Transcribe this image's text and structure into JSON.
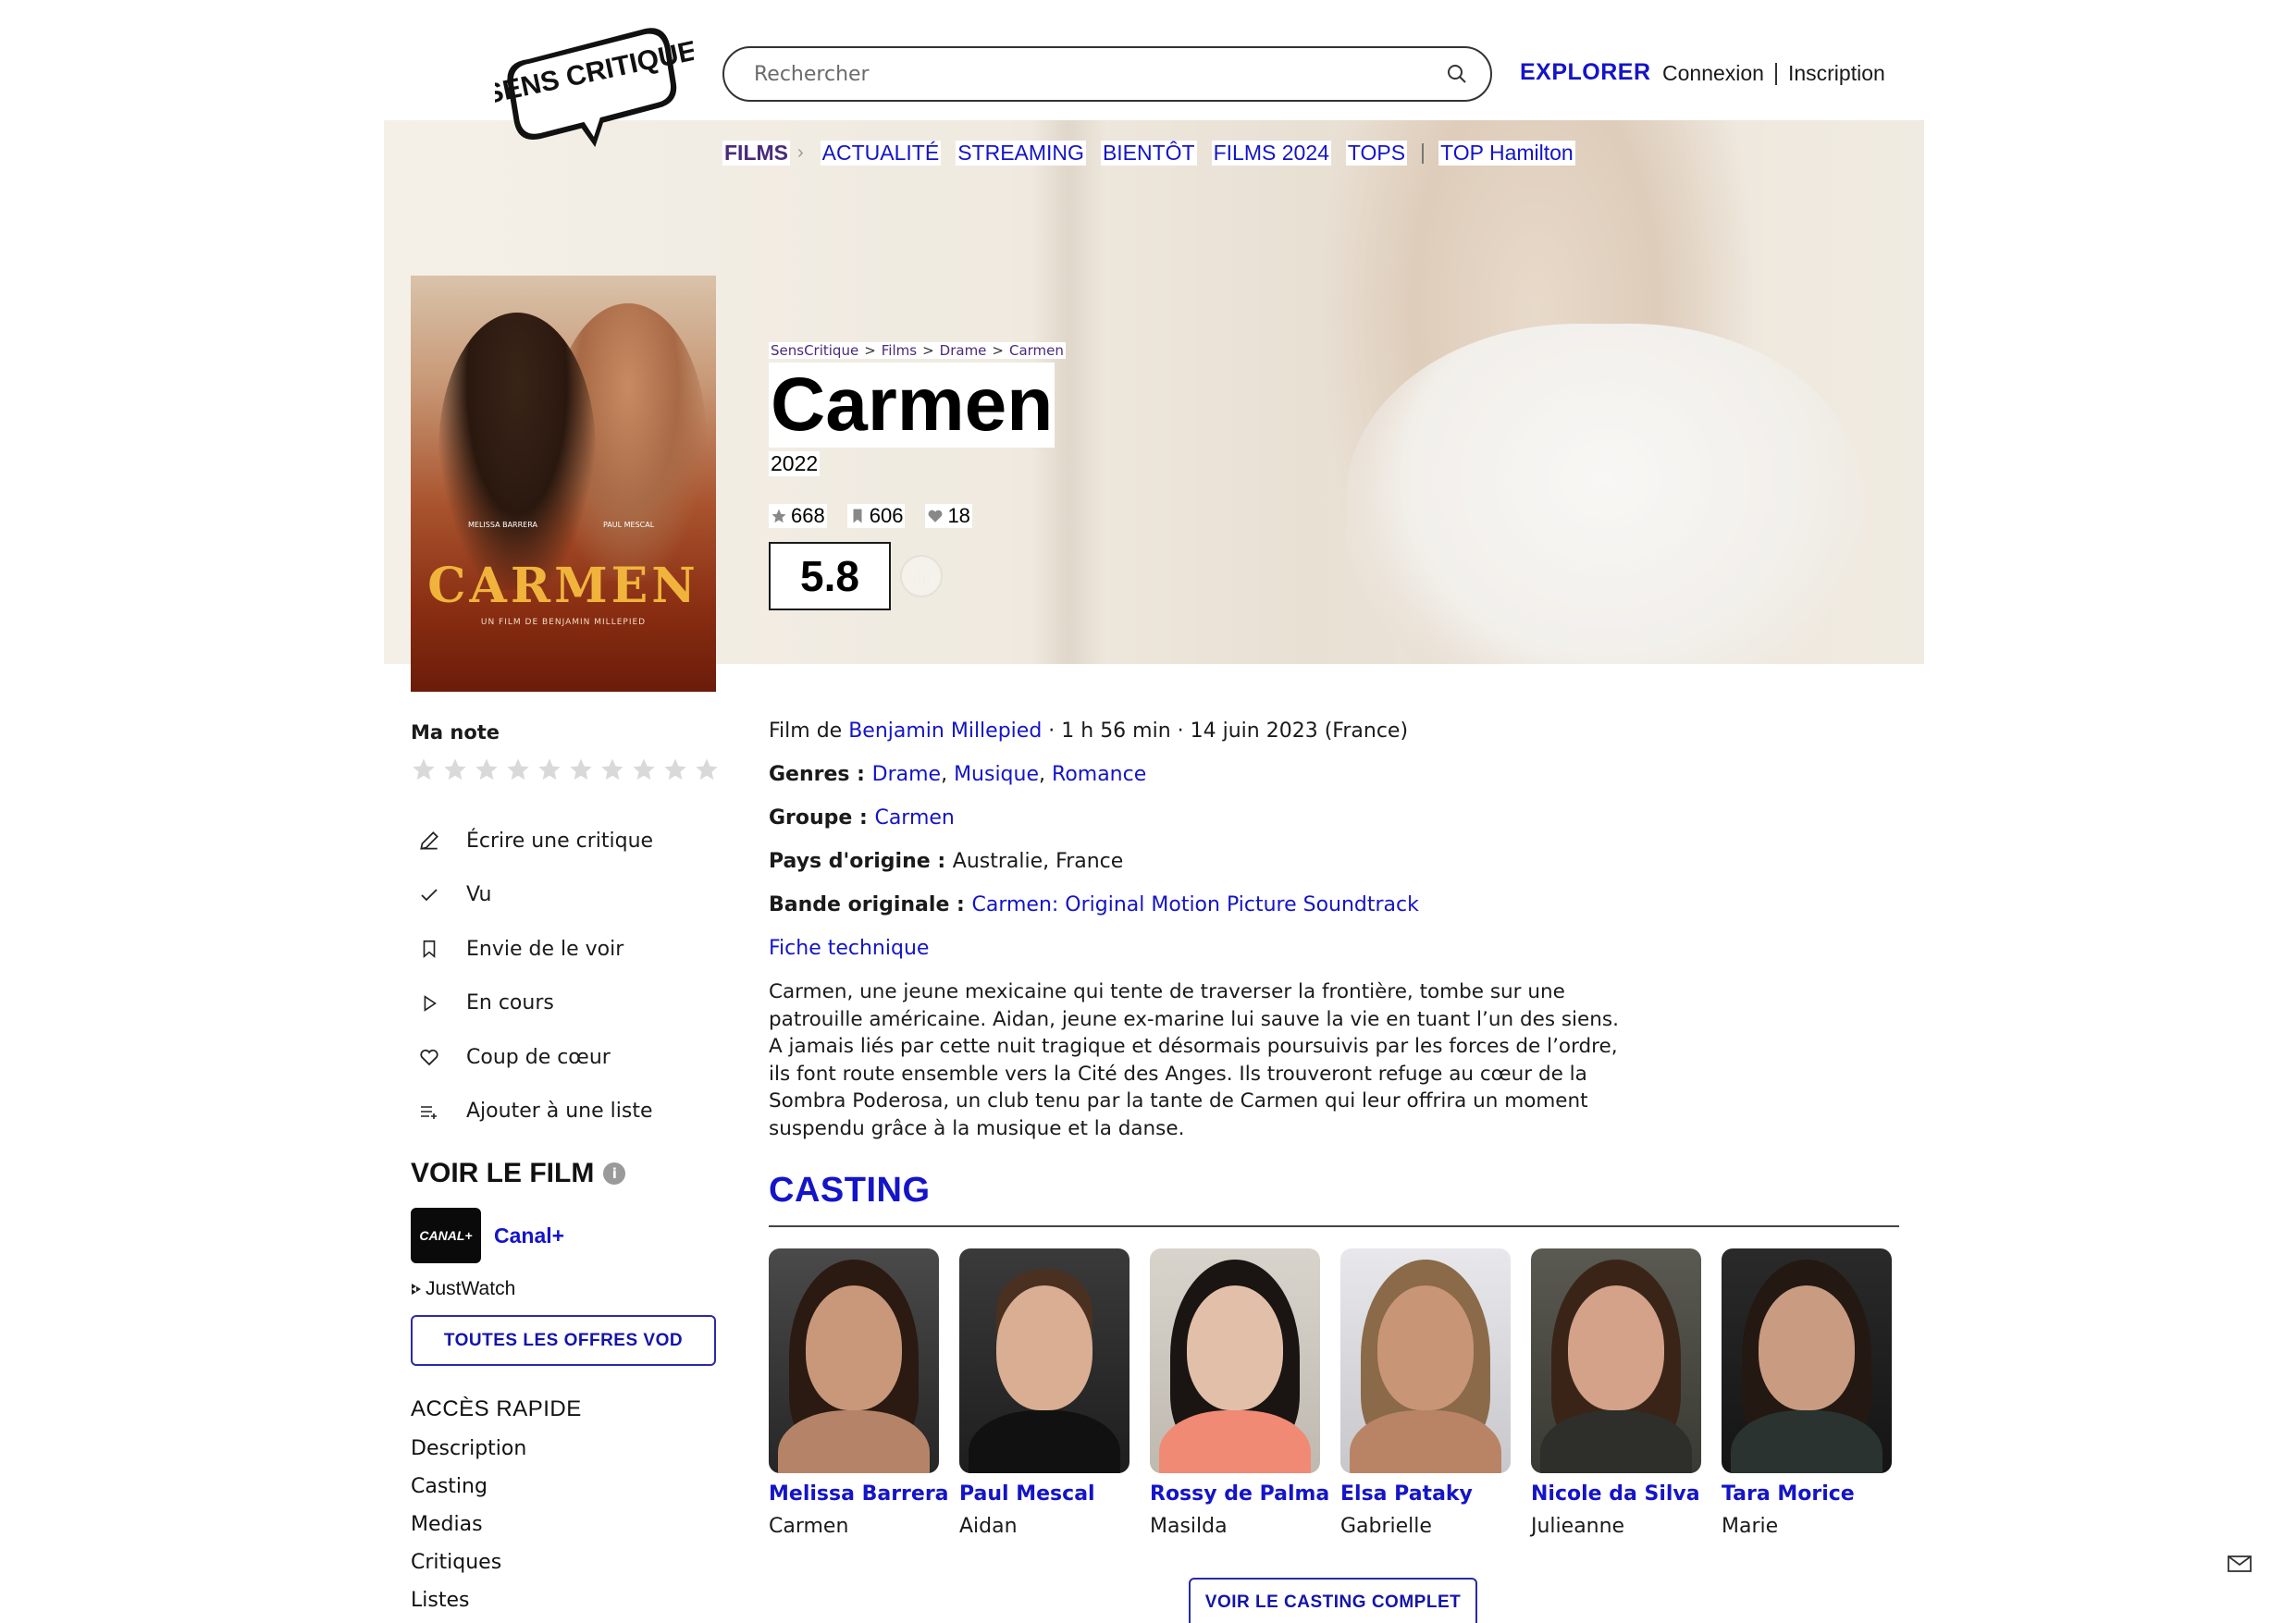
{
  "header": {
    "logo_text": "SENS CRITIQUE",
    "search_placeholder": "Rechercher",
    "explorer_label": "EXPLORER",
    "login_label": "Connexion",
    "signup_label": "Inscription"
  },
  "subnav": {
    "active": "FILMS",
    "items": [
      "ACTUALITÉ",
      "STREAMING",
      "BIENTÔT",
      "FILMS 2024",
      "TOPS"
    ],
    "extra": "TOP Hamilton"
  },
  "poster": {
    "title": "CARMEN",
    "credit": "UN FILM DE BENJAMIN MILLEPIED",
    "actor_left": "MELISSA BARRERA",
    "actor_right": "PAUL MESCAL"
  },
  "breadcrumb": [
    "SensCritique",
    "Films",
    "Drame",
    "Carmen"
  ],
  "film": {
    "title": "Carmen",
    "year": "2022",
    "ratings_count": "668",
    "wishlist_count": "606",
    "favorites_count": "18",
    "score": "5.8"
  },
  "sidebar": {
    "ma_note_label": "Ma note",
    "star_count": 10,
    "actions": [
      {
        "label": "Écrire une critique",
        "icon": "pencil-icon"
      },
      {
        "label": "Vu",
        "icon": "check-icon"
      },
      {
        "label": "Envie de le voir",
        "icon": "bookmark-icon"
      },
      {
        "label": "En cours",
        "icon": "play-icon"
      },
      {
        "label": "Coup de cœur",
        "icon": "heart-icon"
      },
      {
        "label": "Ajouter à une liste",
        "icon": "list-add-icon"
      }
    ],
    "voir_title": "VOIR LE FILM",
    "provider_logo": "CANAL+",
    "provider_name": "Canal+",
    "justwatch": "JustWatch",
    "vod_button": "TOUTES LES OFFRES VOD",
    "acces_title": "ACCÈS RAPIDE",
    "quick_links": [
      "Description",
      "Casting",
      "Medias",
      "Critiques",
      "Listes"
    ]
  },
  "details": {
    "film_de_prefix": "Film de ",
    "director": "Benjamin Millepied",
    "meta": " · 1 h 56 min · 14 juin 2023 (France)",
    "genres_label": "Genres : ",
    "genres": [
      "Drame",
      "Musique",
      "Romance"
    ],
    "groupe_label": "Groupe : ",
    "groupe": "Carmen",
    "pays_label": "Pays d'origine : ",
    "pays": "Australie, France",
    "bo_label": "Bande originale : ",
    "bo": "Carmen: Original Motion Picture Soundtrack",
    "fiche_label": "Fiche technique",
    "synopsis": "Carmen, une jeune mexicaine qui tente de traverser la frontière, tombe sur une patrouille américaine. Aidan, jeune ex-marine lui sauve la vie en tuant l’un des siens. A jamais liés par cette nuit tragique et désormais poursuivis par les forces de l’ordre, ils font route ensemble vers la Cité des Anges. Ils trouveront refuge au cœur de la Sombra Poderosa, un club tenu par la tante de Carmen qui leur offrira un moment suspendu grâce à la musique et la danse."
  },
  "casting": {
    "title": "CASTING",
    "actors": [
      {
        "name": "Melissa Barrera",
        "role": "Carmen"
      },
      {
        "name": "Paul Mescal",
        "role": "Aidan"
      },
      {
        "name": "Rossy de Palma",
        "role": "Masilda"
      },
      {
        "name": "Elsa Pataky",
        "role": "Gabrielle"
      },
      {
        "name": "Nicole da Silva",
        "role": "Julieanne"
      },
      {
        "name": "Tara Morice",
        "role": "Marie"
      }
    ],
    "button": "VOIR LE CASTING COMPLET"
  },
  "colors": {
    "link": "#1414c8",
    "accent_purple": "#4a2a7a",
    "poster_title": "#f0b43c"
  }
}
